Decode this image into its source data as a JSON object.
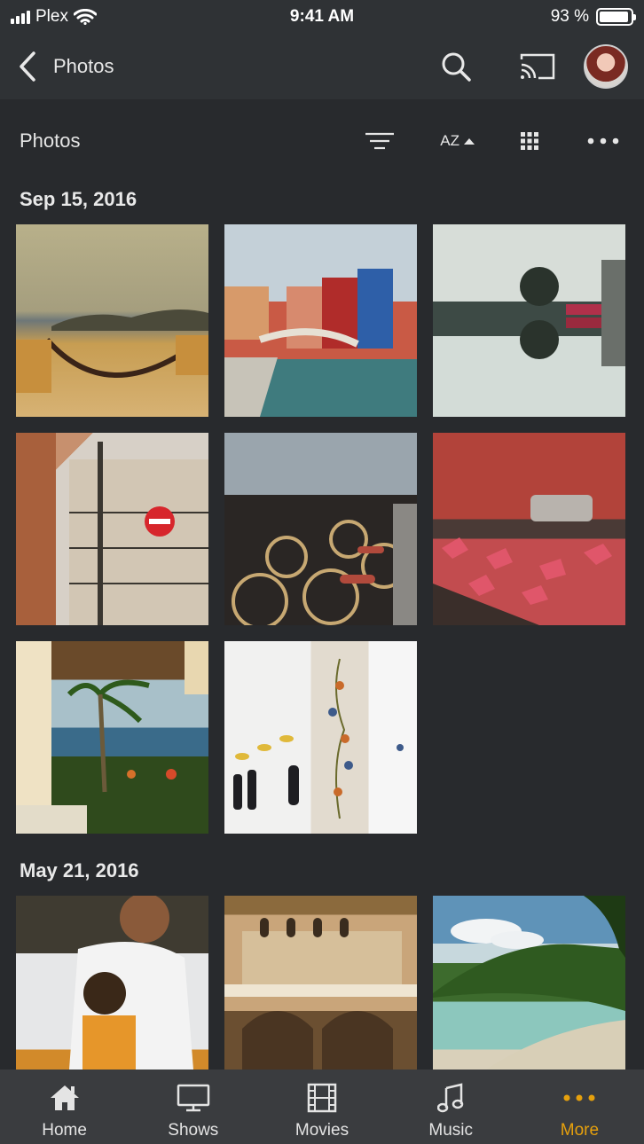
{
  "status_bar": {
    "carrier": "Plex",
    "time": "9:41 AM",
    "battery_text": "93 %",
    "battery_level": 0.93
  },
  "nav": {
    "back_label": "Photos",
    "icons": [
      "back-chevron-icon",
      "search-icon",
      "cast-icon",
      "avatar"
    ]
  },
  "sub_header": {
    "title": "Photos",
    "sort_label": "AZ",
    "icons": [
      "filter-icon",
      "sort-ascending-icon",
      "grid-icon",
      "more-icon"
    ]
  },
  "sections": [
    {
      "date": "Sep 15, 2016",
      "photos": [
        {
          "description": "terrace-hammock-sea"
        },
        {
          "description": "canal-colorful-houses"
        },
        {
          "description": "reflection-village"
        },
        {
          "description": "building-no-entry-sign"
        },
        {
          "description": "parked-bicycles-street"
        },
        {
          "description": "red-plants-street"
        },
        {
          "description": "tropical-beach-palms"
        },
        {
          "description": "mosque-floral-columns"
        }
      ]
    },
    {
      "date": "May 21, 2016",
      "photos": [
        {
          "description": "man-and-child"
        },
        {
          "description": "ornate-arches"
        },
        {
          "description": "beach-cove"
        }
      ]
    }
  ],
  "tab_bar": {
    "items": [
      {
        "label": "Home",
        "icon": "home-icon",
        "active": false
      },
      {
        "label": "Shows",
        "icon": "tv-icon",
        "active": false
      },
      {
        "label": "Movies",
        "icon": "film-icon",
        "active": false
      },
      {
        "label": "Music",
        "icon": "music-note-icon",
        "active": false
      },
      {
        "label": "More",
        "icon": "more-dots-icon",
        "active": true
      }
    ]
  },
  "colors": {
    "background": "#282a2d",
    "bar": "#2f3235",
    "tab_bar": "#3a3c3f",
    "accent": "#e5a00d"
  }
}
